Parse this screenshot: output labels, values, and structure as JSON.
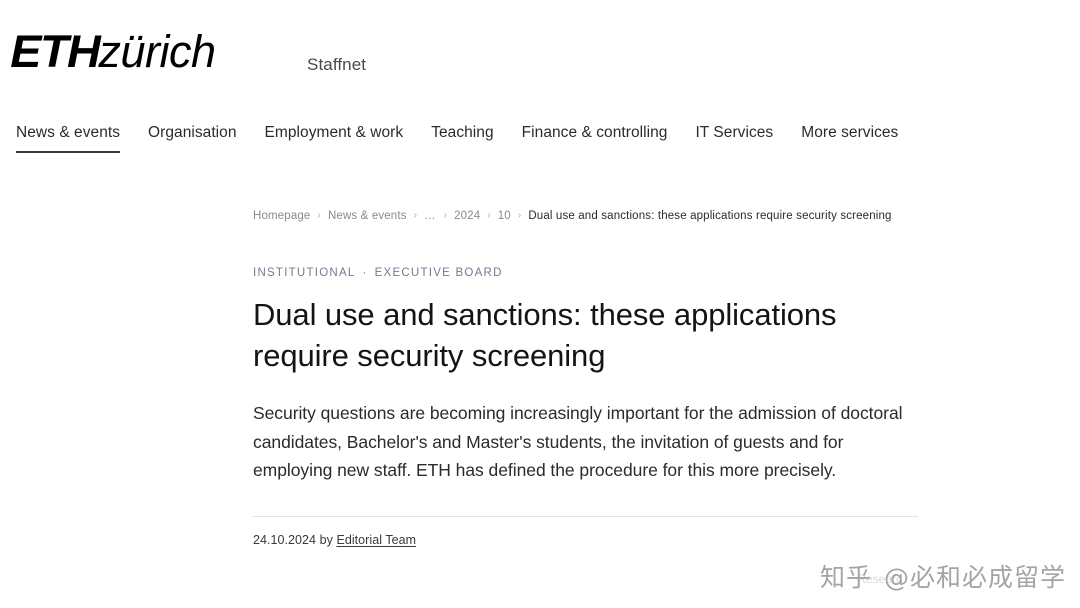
{
  "header": {
    "logo": {
      "bold_part": "ETH",
      "light_part": "zürich"
    },
    "portal_label": "Staffnet",
    "nav_items": [
      {
        "label": "News & events",
        "active": true
      },
      {
        "label": "Organisation",
        "active": false
      },
      {
        "label": "Employment & work",
        "active": false
      },
      {
        "label": "Teaching",
        "active": false
      },
      {
        "label": "Finance & controlling",
        "active": false
      },
      {
        "label": "IT Services",
        "active": false
      },
      {
        "label": "More services",
        "active": false
      }
    ]
  },
  "breadcrumb": {
    "separator": "›",
    "items": [
      {
        "label": "Homepage",
        "current": false
      },
      {
        "label": "News & events",
        "current": false
      },
      {
        "label": "…",
        "current": false
      },
      {
        "label": "2024",
        "current": false
      },
      {
        "label": "10",
        "current": false
      },
      {
        "label": "Dual use and sanctions: these applications require security screening",
        "current": true
      }
    ]
  },
  "article": {
    "categories": [
      "INSTITUTIONAL",
      "EXECUTIVE BOARD"
    ],
    "category_separator": "·",
    "headline": "Dual use and sanctions: these applications require security screening",
    "lead": "Security questions are becoming increasingly important for the admission of doctoral candidates, Bachelor's and Master's students, the invitation of guests and for employing new staff. ETH has defined the procedure for this more precisely.",
    "byline": {
      "date": "24.10.2024",
      "by_word": "by",
      "author": "Editorial Team"
    }
  },
  "watermark": {
    "brand": "知乎",
    "handle": "@必和必成留学",
    "ghost_text": "Researc"
  },
  "colors": {
    "text_primary": "#141414",
    "text_secondary": "#2b2b2b",
    "muted": "#8a8a8a",
    "kicker": "#6e7d90",
    "rule": "#e2e2e2"
  }
}
